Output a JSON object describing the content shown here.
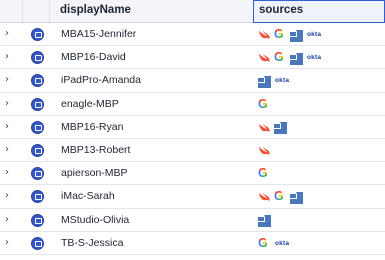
{
  "header": {
    "name_col": "displayName",
    "sources_col": "sources"
  },
  "rows": [
    {
      "name": "MBA15-Jennifer",
      "sources": [
        "swift-icon",
        "google-icon",
        "jamf-icon",
        "okta-logo"
      ]
    },
    {
      "name": "MBP16-David",
      "sources": [
        "swift-icon",
        "google-icon",
        "jamf-icon",
        "okta-logo"
      ]
    },
    {
      "name": "iPadPro-Amanda",
      "sources": [
        "jamf-icon",
        "okta-logo"
      ]
    },
    {
      "name": "enagle-MBP",
      "sources": [
        "google-icon"
      ]
    },
    {
      "name": "MBP16-Ryan",
      "sources": [
        "swift-icon",
        "jamf-icon"
      ]
    },
    {
      "name": "MBP13-Robert",
      "sources": [
        "swift-icon"
      ]
    },
    {
      "name": "apierson-MBP",
      "sources": [
        "google-icon"
      ]
    },
    {
      "name": "iMac-Sarah",
      "sources": [
        "swift-icon",
        "google-icon",
        "jamf-icon"
      ]
    },
    {
      "name": "MStudio-Olivia",
      "sources": [
        "jamf-icon"
      ]
    },
    {
      "name": "TB-S-Jessica",
      "sources": [
        "google-icon",
        "okta-logo"
      ]
    }
  ],
  "icons": {
    "expand": "chevron-right-icon",
    "device": "device-icon",
    "google_letter": "G",
    "okta_text": "okta"
  },
  "colors": {
    "accent": "#2f5fd6",
    "device_badge": "#3657c9",
    "swift": "#f05138",
    "jamf": "#4a78b8",
    "okta": "#1b3f9a"
  }
}
